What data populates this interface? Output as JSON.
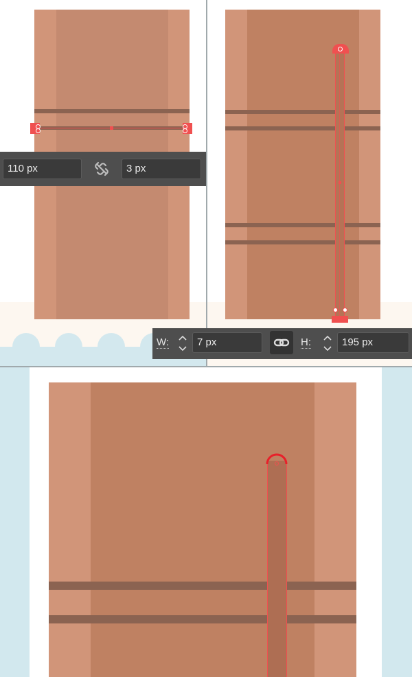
{
  "panel_a": {
    "width_field": "110 px",
    "height_field": "3 px",
    "link_icon": "chain-broken-icon"
  },
  "panel_b": {
    "w_label": "W:",
    "w_value": "7 px",
    "h_label": "H:",
    "h_value": "195 px",
    "link_icon": "chain-linked-icon"
  },
  "colors": {
    "canvas_bg": "#cfe6ec",
    "door_light": "#d09578",
    "door_mid": "#c4876a",
    "door_dark": "#bb7e5f",
    "plank": "#8b6351",
    "strap": "#b06e52",
    "selection": "#f05050",
    "toolbar": "#4e4e4e"
  }
}
